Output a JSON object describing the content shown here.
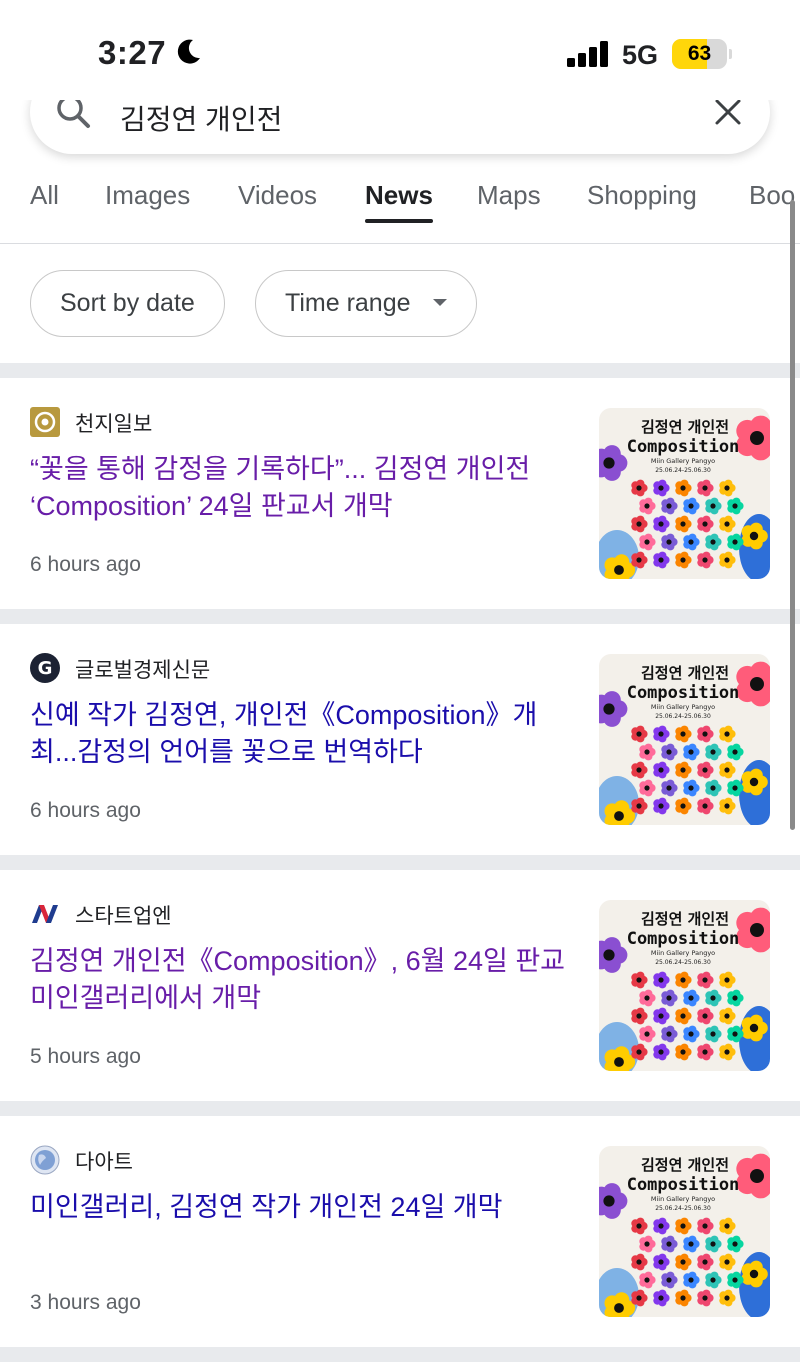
{
  "status": {
    "time": "3:27",
    "network": "5G",
    "battery": "63",
    "battery_level": 0.63
  },
  "search": {
    "query": "김정연 개인전"
  },
  "tabs": [
    "All",
    "Images",
    "Videos",
    "News",
    "Maps",
    "Shopping",
    "Boo"
  ],
  "active_tab": "News",
  "filters": {
    "sort": "Sort by date",
    "time_range": "Time range"
  },
  "thumbnail": {
    "title": "김정연 개인전",
    "subtitle": "Composition",
    "venue": "Miin Gallery Pangyo",
    "dates": "25.06.24-25.06.30"
  },
  "articles": [
    {
      "source": "천지일보",
      "title": "“꽃을 통해 감정을 기록하다”... 김정연 개인전 ‘Composition’ 24일 판교서 개막",
      "age": "6 hours ago",
      "logo": "chunji-logo",
      "visited": true
    },
    {
      "source": "글로벌경제신문",
      "title": "신예 작가 김정연, 개인전《Composition》개최...감정의 언어를 꽃으로 번역하다",
      "age": "6 hours ago",
      "logo": "g-logo",
      "visited": false
    },
    {
      "source": "스타트업엔",
      "title": "김정연 개인전《Composition》, 6월 24일 판교 미인갤러리에서 개막",
      "age": "5 hours ago",
      "logo": "n-logo",
      "visited": true
    },
    {
      "source": "다아트",
      "title": "미인갤러리, 김정연 작가 개인전 24일 개막",
      "age": "3 hours ago",
      "logo": "globe-logo",
      "visited": false
    }
  ],
  "colors": {
    "visited_link": "#681da8",
    "link": "#1a0dab",
    "battery": "#ffd60a"
  }
}
